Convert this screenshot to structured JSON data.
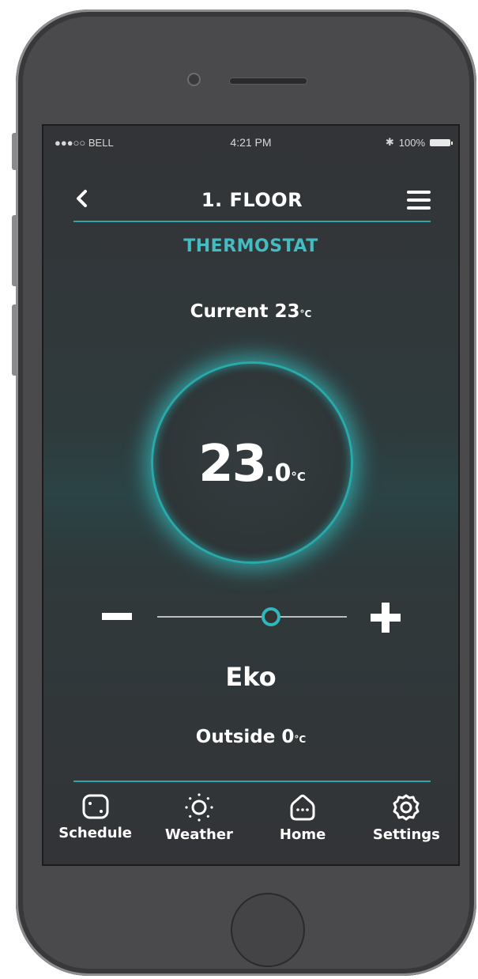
{
  "status_bar": {
    "carrier": "●●●○○ BELL",
    "time": "4:21 PM",
    "bluetooth": "✱",
    "battery": "100%"
  },
  "nav": {
    "title": "1. FLOOR",
    "back_icon": "chevron-left-icon",
    "menu_icon": "hamburger-menu-icon"
  },
  "section_title": "THERMOSTAT",
  "current": {
    "label": "Current 23",
    "unit": "°C"
  },
  "dial": {
    "integer": "23",
    "decimal": ".0",
    "unit": "°C"
  },
  "slider": {
    "value_fraction": 0.6
  },
  "mode": "Eko",
  "outside": {
    "label": "Outside 0",
    "unit": "°C"
  },
  "tabs": [
    {
      "label": "Schedule",
      "icon": "schedule-icon"
    },
    {
      "label": "Weather",
      "icon": "sun-icon"
    },
    {
      "label": "Home",
      "icon": "home-icon"
    },
    {
      "label": "Settings",
      "icon": "gear-icon"
    }
  ],
  "colors": {
    "accent": "#2fb7bb",
    "title_accent": "#44bcc1"
  }
}
